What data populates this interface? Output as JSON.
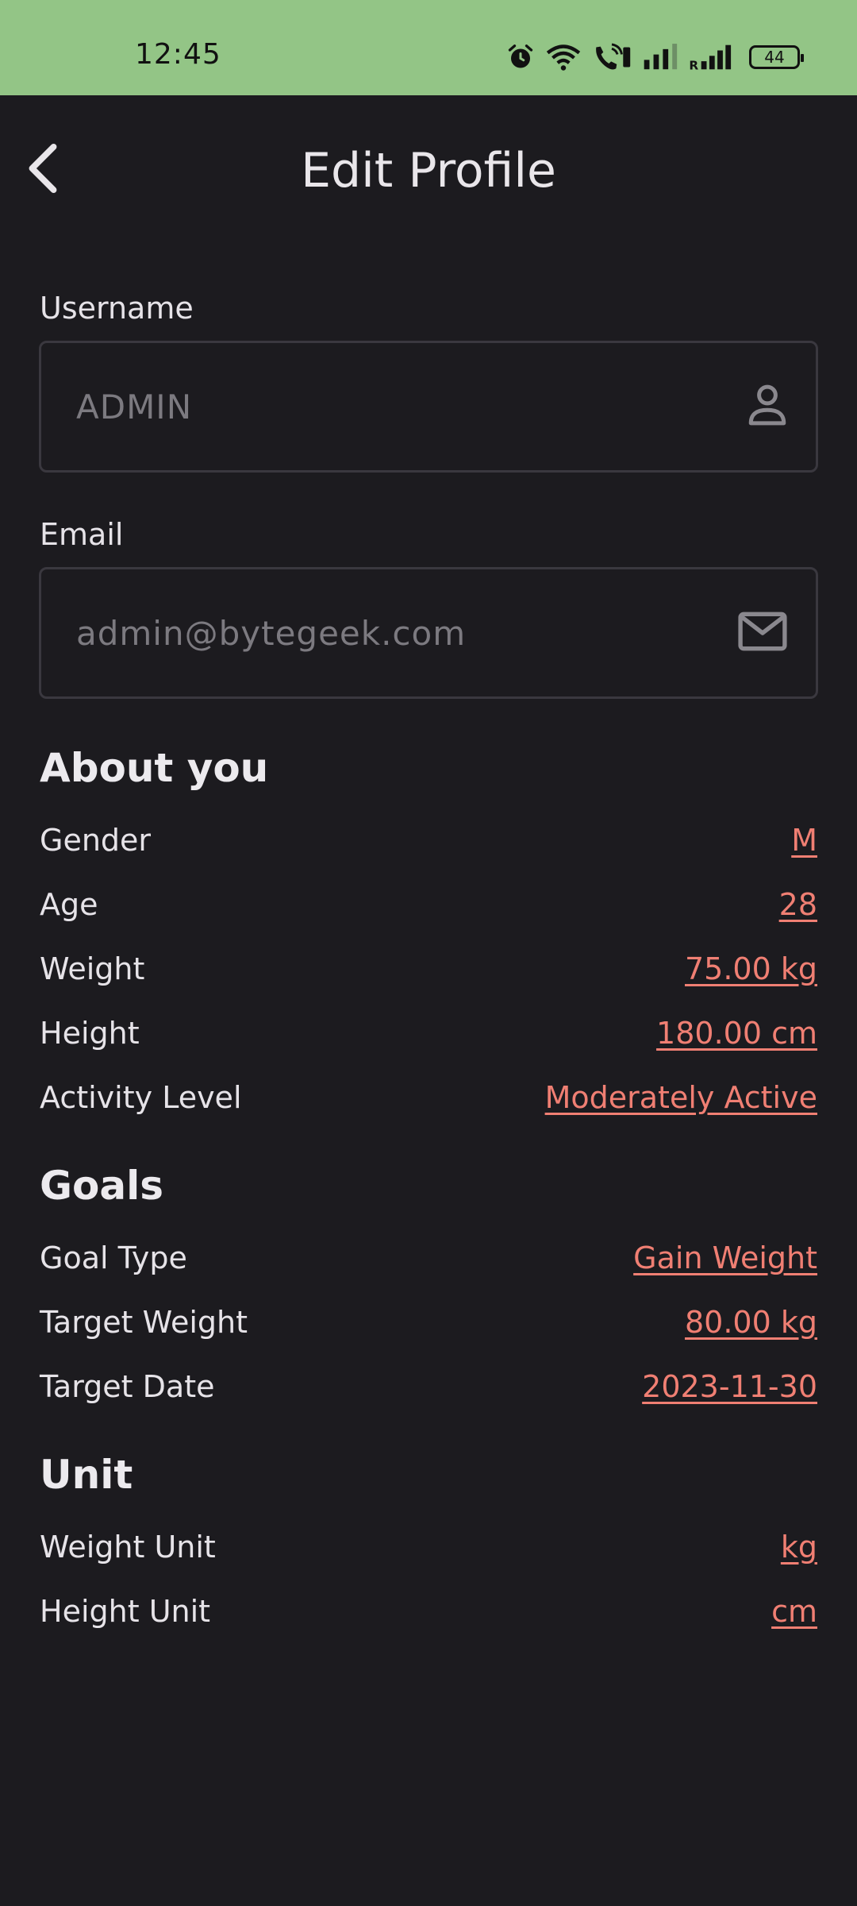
{
  "status_bar": {
    "time": "12:45",
    "battery": "44",
    "icons": [
      "alarm-icon",
      "wifi-icon",
      "wifi-calling-icon",
      "signal-icon",
      "roaming-signal-icon",
      "battery-icon"
    ]
  },
  "header": {
    "title": "Edit Profile",
    "back_icon": "chevron-left-icon"
  },
  "form": {
    "username": {
      "label": "Username",
      "value": "ADMIN",
      "icon": "person-icon"
    },
    "email": {
      "label": "Email",
      "value": "admin@bytegeek.com",
      "icon": "mail-icon"
    }
  },
  "about": {
    "title": "About you",
    "rows": [
      {
        "label": "Gender",
        "value": "M"
      },
      {
        "label": "Age",
        "value": "28"
      },
      {
        "label": "Weight",
        "value": "75.00 kg"
      },
      {
        "label": "Height",
        "value": "180.00 cm"
      },
      {
        "label": "Activity Level",
        "value": "Moderately Active"
      }
    ]
  },
  "goals": {
    "title": "Goals",
    "rows": [
      {
        "label": "Goal Type",
        "value": "Gain Weight"
      },
      {
        "label": "Target Weight",
        "value": "80.00 kg"
      },
      {
        "label": "Target Date",
        "value": "2023-11-30"
      }
    ]
  },
  "unit": {
    "title": "Unit",
    "rows": [
      {
        "label": "Weight Unit",
        "value": "kg"
      },
      {
        "label": "Height Unit",
        "value": "cm"
      }
    ]
  },
  "colors": {
    "status_bar": "#93c586",
    "background": "#1c1b1f",
    "accent_link": "#f07f73",
    "text": "#e6e3e8",
    "field_text": "#7c7a80",
    "field_border": "#3a383f"
  }
}
